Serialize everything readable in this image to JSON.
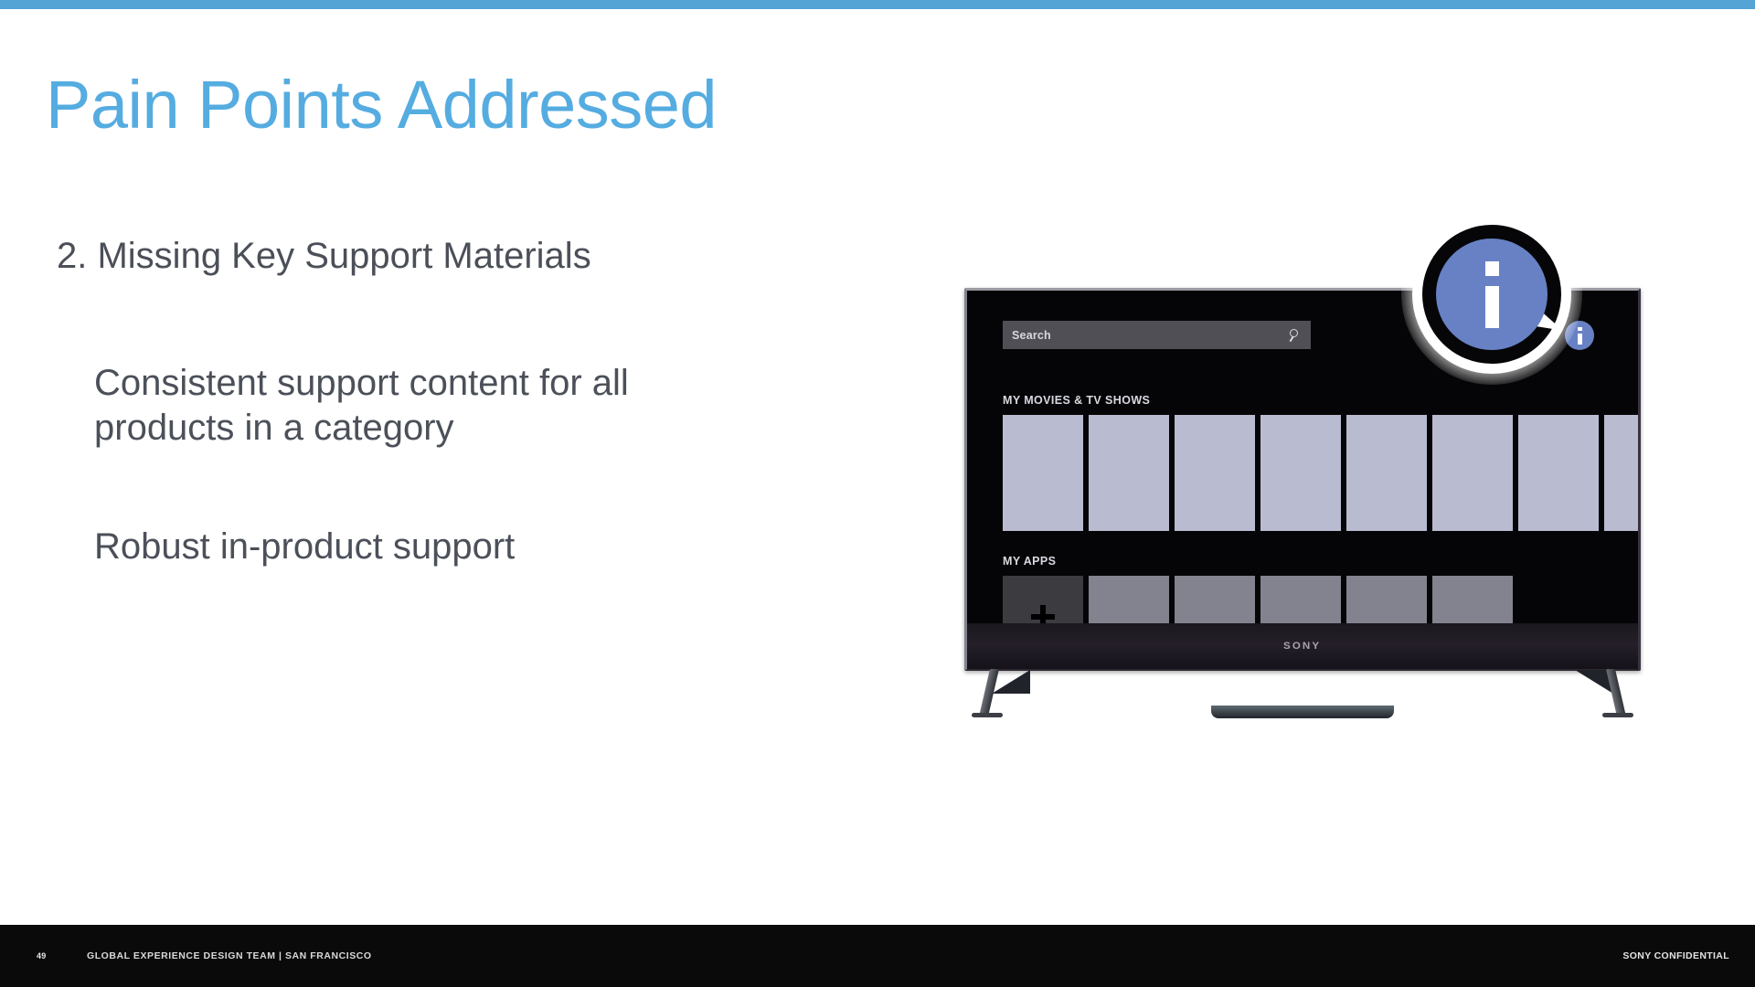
{
  "slide": {
    "title": "Pain Points Addressed",
    "accent_color": "#55ace0",
    "top_bar_color": "#55a4d6",
    "subhead": "2. Missing Key Support Materials",
    "bullets": [
      "Consistent support content for all products in a category",
      "Robust in-product support"
    ]
  },
  "tv": {
    "brand_logo": "SONY",
    "search": {
      "placeholder": "Search",
      "icon": "search-icon"
    },
    "rows": [
      {
        "label": "MY MOVIES & TV SHOWS",
        "tile_count": 8,
        "tile_color": "#b9bcd0"
      },
      {
        "label": "MY APPS",
        "tile_count": 6,
        "tile_color": "#83838f",
        "add_tile_icon": "plus-icon",
        "add_tile_color": "#3c3c40"
      }
    ],
    "info_badge": {
      "glyph": "i",
      "icon": "info-icon",
      "color": "#6781c4"
    }
  },
  "callout": {
    "glyph": "i",
    "icon": "info-icon",
    "circle_color": "#6781c4",
    "ring_color": "#ffffff"
  },
  "footer": {
    "page_number": "49",
    "team": "GLOBAL EXPERIENCE DESIGN TEAM | SAN FRANCISCO",
    "confidential": "SONY CONFIDENTIAL"
  }
}
